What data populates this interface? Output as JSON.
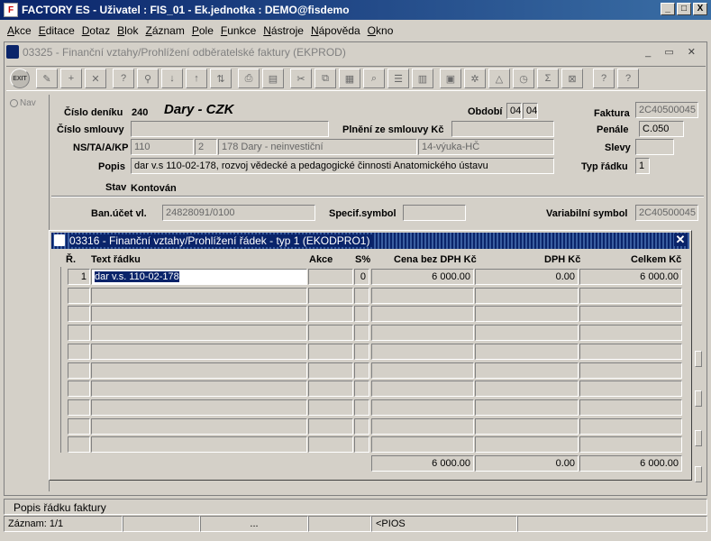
{
  "window": {
    "title": "FACTORY ES - Uživatel : FIS_01 - Ek.jednotka : DEMO@fisdemo",
    "minimize": "_",
    "maximize": "□",
    "close": "X"
  },
  "menu": [
    "Akce",
    "Editace",
    "Dotaz",
    "Blok",
    "Záznam",
    "Pole",
    "Funkce",
    "Nástroje",
    "Nápověda",
    "Okno"
  ],
  "form": {
    "title": "03325 - Finanční vztahy/Prohlížení odběratelské faktury (EKPROD)",
    "frame_buttons": "_ ▭ ✕",
    "exit_label": "EXIT",
    "nav_label": "Nav",
    "cislo_deniku_label": "Číslo deníku",
    "cislo_deniku": "240",
    "book_title": "Dary - CZK",
    "obdobi_label": "Období",
    "obdobi_1": "04",
    "obdobi_2": "04",
    "faktura_label": "Faktura",
    "faktura": "2C40500045",
    "cislo_smlouvy_label": "Číslo smlouvy",
    "cislo_smlouvy": "",
    "plneni_label": "Plnění ze smlouvy Kč",
    "plneni": "",
    "penale_label": "Penále",
    "penale": "C.050",
    "ns_label": "NS/TA/A/KP",
    "ns": "110",
    "ta": "2",
    "a": "178 Dary - neinvestiční",
    "kp": "14-výuka-HČ",
    "slevy_label": "Slevy",
    "slevy": "",
    "popis_label": "Popis",
    "popis": "dar v.s 110-02-178, rozvoj vědecké a pedagogické činnosti Anatomického ústavu",
    "typ_radku_label": "Typ řádku",
    "typ_radku": "1",
    "stav_label": "Stav",
    "stav": "Kontován",
    "ban_ucet_label": "Ban.účet vl.",
    "ban_ucet": "24828091/0100",
    "specif_label": "Specif.symbol",
    "specif": "",
    "variabilni_label": "Variabilní symbol",
    "variabilni": "2C40500045"
  },
  "subwindow": {
    "title": "03316 - Finanční vztahy/Prohlížení řádek - typ 1 (EKODPRO1)",
    "close": "✕",
    "headers": {
      "r": "Ř.",
      "text": "Text řádku",
      "akce": "Akce",
      "s": "S%",
      "cena": "Cena bez DPH Kč",
      "dph": "DPH Kč",
      "celkem": "Celkem Kč"
    },
    "rows": [
      {
        "r": "1",
        "text": "dar v.s. 110-02-178",
        "akce": "",
        "s": "0",
        "cena": "6 000.00",
        "dph": "0.00",
        "celkem": "6 000.00"
      }
    ],
    "totals": {
      "cena": "6 000.00",
      "dph": "0.00",
      "celkem": "6 000.00"
    }
  },
  "status": {
    "hint": "Popis řádku faktury",
    "record": "Záznam: 1/1",
    "seg2": "",
    "seg3": "...",
    "seg4": "",
    "mode": "<PIOS"
  }
}
